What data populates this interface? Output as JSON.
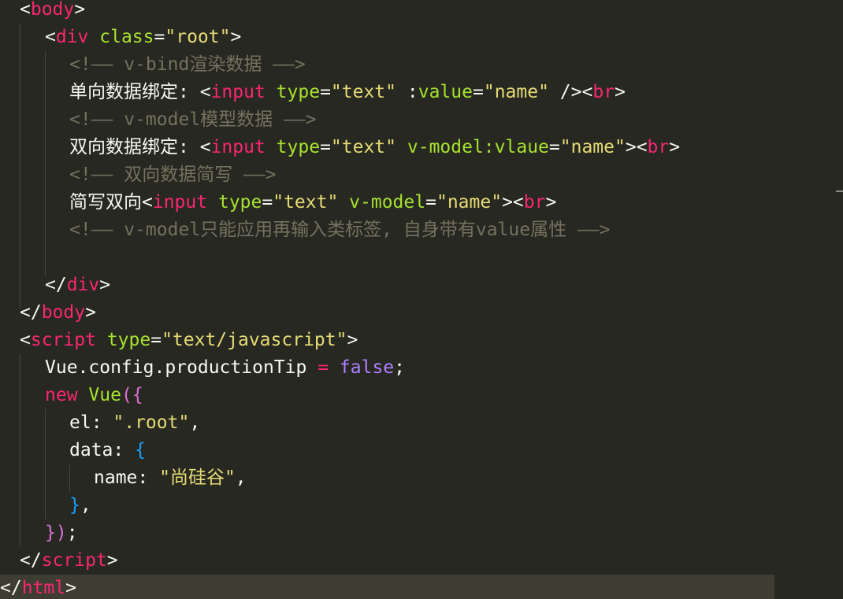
{
  "editor": {
    "language": "html",
    "lines": [
      [
        {
          "t": "<",
          "k": "punct"
        },
        {
          "t": "body",
          "k": "tag"
        },
        {
          "t": ">",
          "k": "punct"
        }
      ],
      [
        {
          "t": "<",
          "k": "punct"
        },
        {
          "t": "div",
          "k": "tag"
        },
        {
          "t": " ",
          "k": "plain"
        },
        {
          "t": "class",
          "k": "attr"
        },
        {
          "t": "=",
          "k": "punct"
        },
        {
          "t": "\"root\"",
          "k": "str"
        },
        {
          "t": ">",
          "k": "punct"
        }
      ],
      [
        {
          "t": "<!—— v-bind渲染数据 ——>",
          "k": "comment"
        }
      ],
      [
        {
          "t": "单向数据绑定: ",
          "k": "plain"
        },
        {
          "t": "<",
          "k": "punct"
        },
        {
          "t": "input",
          "k": "tag"
        },
        {
          "t": " ",
          "k": "plain"
        },
        {
          "t": "type",
          "k": "attr"
        },
        {
          "t": "=",
          "k": "punct"
        },
        {
          "t": "\"text\"",
          "k": "str"
        },
        {
          "t": " ",
          "k": "plain"
        },
        {
          "t": ":",
          "k": "punct"
        },
        {
          "t": "value",
          "k": "attr"
        },
        {
          "t": "=",
          "k": "punct"
        },
        {
          "t": "\"name\"",
          "k": "str"
        },
        {
          "t": " />",
          "k": "punct"
        },
        {
          "t": "<",
          "k": "punct"
        },
        {
          "t": "br",
          "k": "tag"
        },
        {
          "t": ">",
          "k": "punct"
        }
      ],
      [
        {
          "t": "<!—— v-model模型数据 ——>",
          "k": "comment"
        }
      ],
      [
        {
          "t": "双向数据绑定: ",
          "k": "plain"
        },
        {
          "t": "<",
          "k": "punct"
        },
        {
          "t": "input",
          "k": "tag"
        },
        {
          "t": " ",
          "k": "plain"
        },
        {
          "t": "type",
          "k": "attr"
        },
        {
          "t": "=",
          "k": "punct"
        },
        {
          "t": "\"text\"",
          "k": "str"
        },
        {
          "t": " ",
          "k": "plain"
        },
        {
          "t": "v-model:vlaue",
          "k": "attr"
        },
        {
          "t": "=",
          "k": "punct"
        },
        {
          "t": "\"name\"",
          "k": "str"
        },
        {
          "t": "><",
          "k": "punct"
        },
        {
          "t": "br",
          "k": "tag"
        },
        {
          "t": ">",
          "k": "punct"
        }
      ],
      [
        {
          "t": "<!—— 双向数据简写 ——>",
          "k": "comment"
        }
      ],
      [
        {
          "t": "简写双向",
          "k": "plain"
        },
        {
          "t": "<",
          "k": "punct"
        },
        {
          "t": "input",
          "k": "tag"
        },
        {
          "t": " ",
          "k": "plain"
        },
        {
          "t": "type",
          "k": "attr"
        },
        {
          "t": "=",
          "k": "punct"
        },
        {
          "t": "\"text\"",
          "k": "str"
        },
        {
          "t": " ",
          "k": "plain"
        },
        {
          "t": "v-model",
          "k": "attr"
        },
        {
          "t": "=",
          "k": "punct"
        },
        {
          "t": "\"name\"",
          "k": "str"
        },
        {
          "t": "><",
          "k": "punct"
        },
        {
          "t": "br",
          "k": "tag"
        },
        {
          "t": ">",
          "k": "punct"
        }
      ],
      [
        {
          "t": "<!—— v-model只能应用再输入类标签, 自身带有value属性 ——>",
          "k": "comment"
        }
      ],
      [],
      [
        {
          "t": "</",
          "k": "punct"
        },
        {
          "t": "div",
          "k": "tag"
        },
        {
          "t": ">",
          "k": "punct"
        }
      ],
      [
        {
          "t": "</",
          "k": "punct"
        },
        {
          "t": "body",
          "k": "tag"
        },
        {
          "t": ">",
          "k": "punct"
        }
      ],
      [
        {
          "t": "<",
          "k": "punct"
        },
        {
          "t": "script",
          "k": "tag"
        },
        {
          "t": " ",
          "k": "plain"
        },
        {
          "t": "type",
          "k": "attr"
        },
        {
          "t": "=",
          "k": "punct"
        },
        {
          "t": "\"text/javascript\"",
          "k": "str"
        },
        {
          "t": ">",
          "k": "punct"
        }
      ],
      [
        {
          "t": "Vue.config.productionTip ",
          "k": "plain"
        },
        {
          "t": "=",
          "k": "kw"
        },
        {
          "t": " ",
          "k": "plain"
        },
        {
          "t": "false",
          "k": "bool"
        },
        {
          "t": ";",
          "k": "plain"
        }
      ],
      [
        {
          "t": "new",
          "k": "kw"
        },
        {
          "t": " ",
          "k": "plain"
        },
        {
          "t": "Vue",
          "k": "cls"
        },
        {
          "t": "(",
          "k": "brace1"
        },
        {
          "t": "{",
          "k": "brace1"
        }
      ],
      [
        {
          "t": "el: ",
          "k": "plain"
        },
        {
          "t": "\".root\"",
          "k": "str"
        },
        {
          "t": ",",
          "k": "plain"
        }
      ],
      [
        {
          "t": "data: ",
          "k": "plain"
        },
        {
          "t": "{",
          "k": "brace2"
        }
      ],
      [
        {
          "t": "name: ",
          "k": "plain"
        },
        {
          "t": "\"尚硅谷\"",
          "k": "str"
        },
        {
          "t": ",",
          "k": "plain"
        }
      ],
      [
        {
          "t": "}",
          "k": "brace2"
        },
        {
          "t": ",",
          "k": "plain"
        }
      ],
      [
        {
          "t": "}",
          "k": "brace1"
        },
        {
          "t": ")",
          "k": "brace1"
        },
        {
          "t": ";",
          "k": "plain"
        }
      ],
      [
        {
          "t": "</",
          "k": "punct"
        },
        {
          "t": "script",
          "k": "tag"
        },
        {
          "t": ">",
          "k": "punct"
        }
      ],
      [
        {
          "t": "</",
          "k": "punct"
        },
        {
          "t": "html",
          "k": "tag"
        },
        {
          "t": ">",
          "k": "punct"
        }
      ]
    ]
  }
}
